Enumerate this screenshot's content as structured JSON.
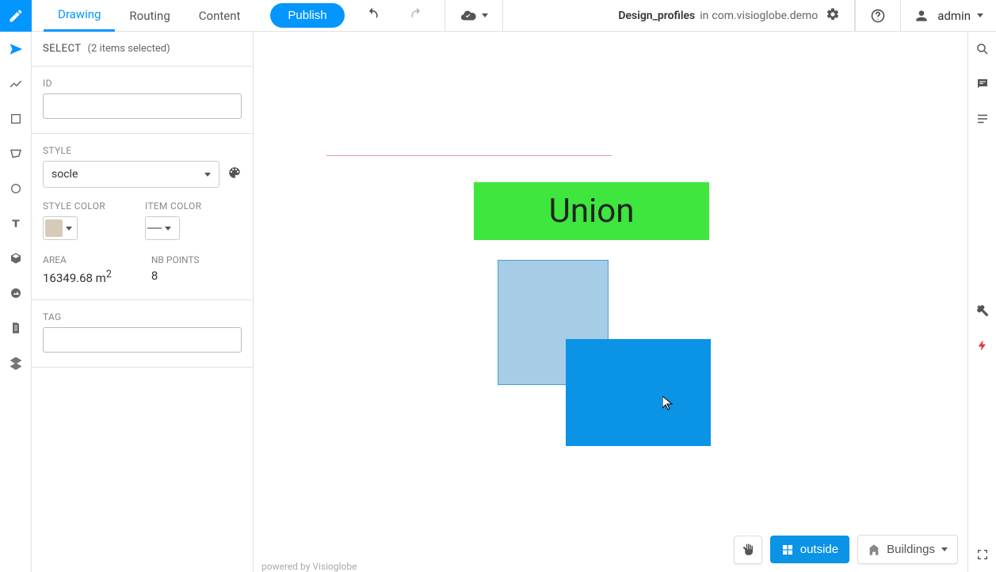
{
  "header": {
    "tabs": [
      "Drawing",
      "Routing",
      "Content"
    ],
    "publish": "Publish",
    "doc_name": "Design_profiles",
    "doc_in": "in",
    "doc_app": "com.visioglobe.demo",
    "user": "admin"
  },
  "selection": {
    "title": "SELECT",
    "count_text": "(2 items selected)"
  },
  "panel": {
    "id_label": "ID",
    "id_value": "",
    "style_label": "STYLE",
    "style_value": "socle",
    "style_color_label": "STYLE COLOR",
    "item_color_label": "ITEM COLOR",
    "area_label": "AREA",
    "area_value": "16349.68 m",
    "area_exp": "2",
    "points_label": "NB POINTS",
    "points_value": "8",
    "tag_label": "TAG",
    "tag_value": ""
  },
  "canvas": {
    "union_label": "Union",
    "footer": "powered by Visioglobe"
  },
  "controls": {
    "outside": "outside",
    "buildings": "Buildings"
  }
}
